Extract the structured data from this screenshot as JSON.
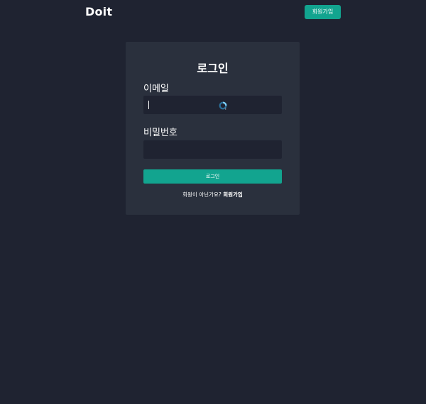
{
  "header": {
    "logo": "Doit",
    "signup_button": "회원가입"
  },
  "login_card": {
    "title": "로그인",
    "email_label": "이메일",
    "email_value": "",
    "password_label": "비밀번호",
    "password_value": "",
    "submit_label": "로그인",
    "signup_prompt": "회원이 아닌가요?",
    "signup_link": "회원가입"
  },
  "icons": {
    "loading_cursor": "loading-spinner-icon"
  },
  "colors": {
    "background": "#1f2331",
    "card": "#2a303d",
    "accent": "#12a48f",
    "text": "#ffffff"
  }
}
